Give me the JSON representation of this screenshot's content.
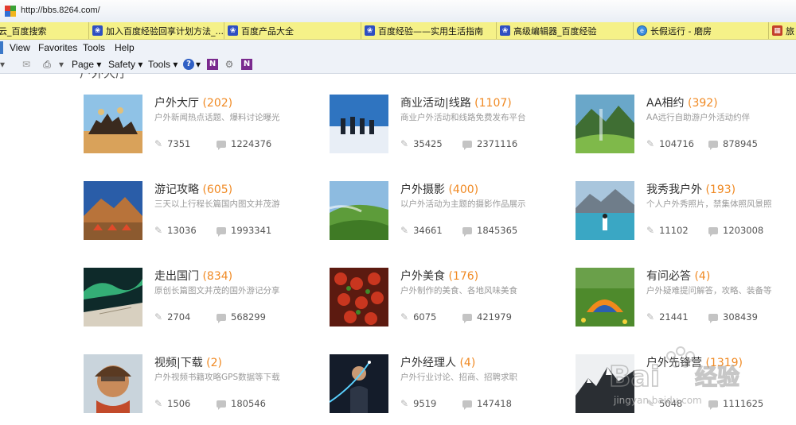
{
  "browser": {
    "url": "http://bbs.8264.com/",
    "favorites": [
      {
        "label": "云_百度搜索",
        "icon": "none"
      },
      {
        "label": "加入百度经验回享计划方法_...",
        "icon": "baidu-paw-icon"
      },
      {
        "label": "百度产品大全",
        "icon": "baidu-paw-icon"
      },
      {
        "label": "百度经验——实用生活指南",
        "icon": "baidu-paw-icon"
      },
      {
        "label": "高级编辑器_百度经验",
        "icon": "baidu-paw-icon"
      },
      {
        "label": "长假远行 - 磨房",
        "icon": "ie-icon"
      },
      {
        "label": "旅",
        "icon": "site-icon"
      }
    ],
    "menu": [
      "View",
      "Favorites",
      "Tools",
      "Help"
    ],
    "commands": {
      "page": "Page ▾",
      "safety": "Safety ▾",
      "tools": "Tools ▾",
      "help": "▾"
    }
  },
  "section": {
    "heading": "户外大厅"
  },
  "forums": [
    {
      "name": "户外大厅",
      "count": "(202)",
      "desc": "户外新闻热点话题、爆料讨论曝光",
      "threads": "7351",
      "posts": "1224376",
      "thumb": "horse-riders"
    },
    {
      "name": "商业活动|线路",
      "count": "(1107)",
      "desc": "商业户外活动和线路免费发布平台",
      "threads": "35425",
      "posts": "2371116",
      "thumb": "hikers-snow"
    },
    {
      "name": "AA相约",
      "count": "(392)",
      "desc": "AA远行自助游户外活动约伴",
      "threads": "104716",
      "posts": "878945",
      "thumb": "valley"
    },
    {
      "name": "游记攻略",
      "count": "(605)",
      "desc": "三天以上行程长篇国内图文并茂游",
      "threads": "13036",
      "posts": "1993341",
      "thumb": "tents-mountain"
    },
    {
      "name": "户外摄影",
      "count": "(400)",
      "desc": "以户外活动为主题的摄影作品展示",
      "threads": "34661",
      "posts": "1845365",
      "thumb": "green-hills"
    },
    {
      "name": "我秀我户外",
      "count": "(193)",
      "desc": "个人户外秀照片，禁集体照风景照",
      "threads": "11102",
      "posts": "1203008",
      "thumb": "lake-girl"
    },
    {
      "name": "走出国门",
      "count": "(834)",
      "desc": "原创长篇图文并茂的国外游记分享",
      "threads": "2704",
      "posts": "568299",
      "thumb": "aurora"
    },
    {
      "name": "户外美食",
      "count": "(176)",
      "desc": "户外制作的美食、各地风味美食",
      "threads": "6075",
      "posts": "421979",
      "thumb": "bbq"
    },
    {
      "name": "有问必答",
      "count": "(4)",
      "desc": "户外疑难提问解答，攻略、装备等",
      "threads": "21441",
      "posts": "308439",
      "thumb": "tent-grass"
    },
    {
      "name": "视频|下载",
      "count": "(2)",
      "desc": "户外视频书籍攻略GPS数据等下载",
      "threads": "1506",
      "posts": "180546",
      "thumb": "climber"
    },
    {
      "name": "户外经理人",
      "count": "(4)",
      "desc": "户外行业讨论、招商、招聘求职",
      "threads": "9519",
      "posts": "147418",
      "thumb": "businessman"
    },
    {
      "name": "户外先锋营",
      "count": "(1319)",
      "desc": "",
      "threads": "5048",
      "posts": "1111625",
      "thumb": "bw-peaks"
    }
  ],
  "watermark": {
    "brand": "Bai",
    "brand2": "经验",
    "url": "jingyan.baidu.com"
  },
  "colors": {
    "count": "#f08a24",
    "favbar": "#f5f188"
  }
}
